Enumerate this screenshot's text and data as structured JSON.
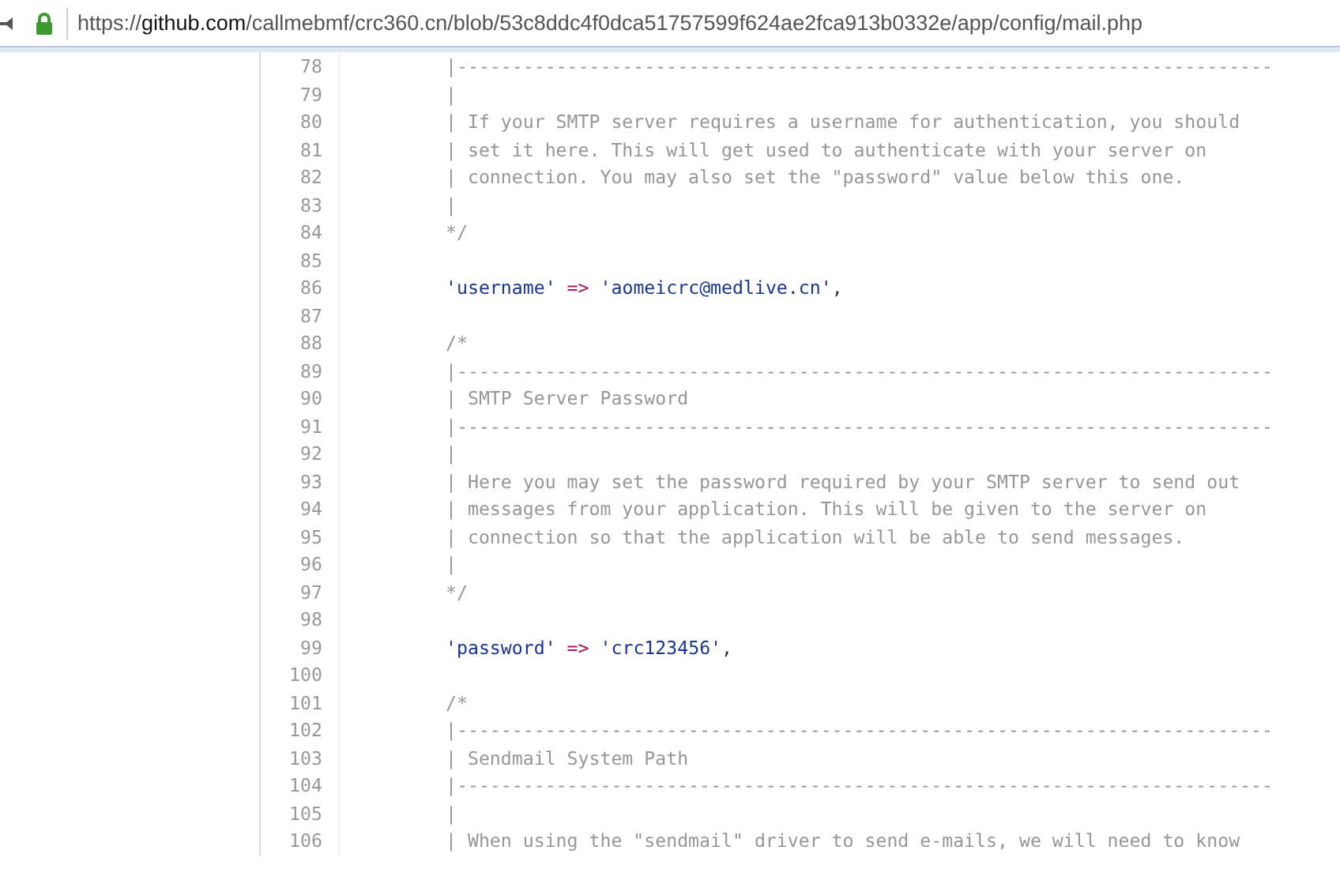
{
  "address_bar": {
    "scheme": "https://",
    "host": "github.com",
    "path": "/callmebmf/crc360.cn/blob/53c8ddc4f0dca51757599f624ae2fca913b0332e/app/config/mail.php"
  },
  "code_lines": [
    {
      "number": "78",
      "kind": "comment",
      "text": "|--------------------------------------------------------------------------"
    },
    {
      "number": "79",
      "kind": "comment",
      "text": "|"
    },
    {
      "number": "80",
      "kind": "comment",
      "text": "| If your SMTP server requires a username for authentication, you should"
    },
    {
      "number": "81",
      "kind": "comment",
      "text": "| set it here. This will get used to authenticate with your server on"
    },
    {
      "number": "82",
      "kind": "comment",
      "text": "| connection. You may also set the \"password\" value below this one."
    },
    {
      "number": "83",
      "kind": "comment",
      "text": "|"
    },
    {
      "number": "84",
      "kind": "comment",
      "text": "*/"
    },
    {
      "number": "85",
      "kind": "blank"
    },
    {
      "number": "86",
      "kind": "assign",
      "key": "'username'",
      "op": "=>",
      "value": "'aomeicrc@medlive.cn'",
      "tail": ","
    },
    {
      "number": "87",
      "kind": "blank"
    },
    {
      "number": "88",
      "kind": "comment",
      "text": "/*"
    },
    {
      "number": "89",
      "kind": "comment",
      "text": "|--------------------------------------------------------------------------"
    },
    {
      "number": "90",
      "kind": "comment",
      "text": "| SMTP Server Password"
    },
    {
      "number": "91",
      "kind": "comment",
      "text": "|--------------------------------------------------------------------------"
    },
    {
      "number": "92",
      "kind": "comment",
      "text": "|"
    },
    {
      "number": "93",
      "kind": "comment",
      "text": "| Here you may set the password required by your SMTP server to send out"
    },
    {
      "number": "94",
      "kind": "comment",
      "text": "| messages from your application. This will be given to the server on"
    },
    {
      "number": "95",
      "kind": "comment",
      "text": "| connection so that the application will be able to send messages."
    },
    {
      "number": "96",
      "kind": "comment",
      "text": "|"
    },
    {
      "number": "97",
      "kind": "comment",
      "text": "*/"
    },
    {
      "number": "98",
      "kind": "blank"
    },
    {
      "number": "99",
      "kind": "assign",
      "key": "'password'",
      "op": "=>",
      "value": "'crc123456'",
      "tail": ","
    },
    {
      "number": "100",
      "kind": "blank"
    },
    {
      "number": "101",
      "kind": "comment",
      "text": "/*"
    },
    {
      "number": "102",
      "kind": "comment",
      "text": "|--------------------------------------------------------------------------"
    },
    {
      "number": "103",
      "kind": "comment",
      "text": "| Sendmail System Path"
    },
    {
      "number": "104",
      "kind": "comment",
      "text": "|--------------------------------------------------------------------------"
    },
    {
      "number": "105",
      "kind": "comment",
      "text": "|"
    },
    {
      "number": "106",
      "kind": "comment",
      "text": "| When using the \"sendmail\" driver to send e-mails, we will need to know"
    }
  ]
}
